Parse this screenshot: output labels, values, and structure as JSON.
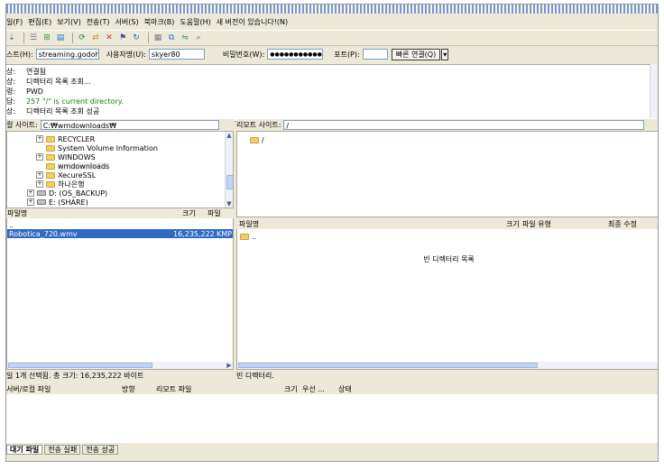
{
  "menu": [
    "일(F)",
    "편집(E)",
    "보기(V)",
    "전송(T)",
    "서버(S)",
    "북마크(B)",
    "도움말(H)",
    "새 버전이 있습니다!(N)"
  ],
  "toolbar": {
    "icons": [
      "site-manager-icon",
      "log-icon",
      "tree-icon",
      "queue-icon",
      "refresh-icon",
      "process-queue-icon",
      "cancel-icon",
      "disconnect-icon",
      "reconnect-icon",
      "filter-icon",
      "compare-icon",
      "sync-icon",
      "search-icon"
    ]
  },
  "quickconnect": {
    "host_label": "스트(H):",
    "host_value": "streaming.godohos",
    "user_label": "사용자명(U):",
    "user_value": "skyer80",
    "pass_label": "비밀번호(W):",
    "pass_value": "●●●●●●●●●●●",
    "port_label": "포트(P):",
    "port_value": "",
    "connect_label": "빠른 연결(Q)",
    "dropdown_label": "▾"
  },
  "log": [
    {
      "prefix": "상:",
      "text": "연결됨",
      "color": "#000000"
    },
    {
      "prefix": "상:",
      "text": "디렉터리 목록 조회...",
      "color": "#000000"
    },
    {
      "prefix": "령:",
      "text": "PWD",
      "color": "#000000"
    },
    {
      "prefix": "답:",
      "text": "257 \"/\" is current directory.",
      "color": "#1a7a1a"
    },
    {
      "prefix": "상:",
      "text": "디렉터리 목록 조회 성공",
      "color": "#000000"
    }
  ],
  "local": {
    "site_label": "컬 사이트:",
    "path": "C:₩wmdownloads₩",
    "tree": [
      {
        "label": "RECYCLER",
        "type": "folder",
        "expander": "+",
        "indent": 2
      },
      {
        "label": "System Volume Information",
        "type": "folder",
        "expander": "",
        "indent": 2
      },
      {
        "label": "WINDOWS",
        "type": "folder",
        "expander": "+",
        "indent": 2
      },
      {
        "label": "wmdownloads",
        "type": "folder",
        "expander": "",
        "indent": 2
      },
      {
        "label": "XecureSSL",
        "type": "folder",
        "expander": "+",
        "indent": 2
      },
      {
        "label": "하나은행",
        "type": "folder",
        "expander": "+",
        "indent": 2
      },
      {
        "label": "D: (OS_BACKUP)",
        "type": "drive",
        "expander": "+",
        "indent": 1
      },
      {
        "label": "E: (SHARE)",
        "type": "drive",
        "expander": "+",
        "indent": 1
      }
    ],
    "columns": [
      "파일명",
      "크기",
      "파일"
    ],
    "files": [
      {
        "name": "..",
        "size": "",
        "type": "",
        "selected": false
      },
      {
        "name": "Robotica_720.wmv",
        "size": "16,235,222",
        "type": "KMP",
        "selected": true
      }
    ],
    "status": "일 1개 선택됨. 총 크기: 16,235,222 바이트"
  },
  "remote": {
    "site_label": "리모트 사이트:",
    "path": "/",
    "tree": [
      {
        "label": "/"
      }
    ],
    "columns": [
      "파일명",
      "크기",
      "파일 유형",
      "최종 수정"
    ],
    "files": [
      {
        "name": ".."
      }
    ],
    "empty_message": "빈 디렉터리 목록",
    "status": "빈 디렉터리."
  },
  "queue": {
    "columns": [
      "서버/로컬 파일",
      "방향",
      "리모트 파일",
      "크기",
      "우선 ...",
      "상태"
    ],
    "tabs": [
      "대기 파일",
      "전송 실패",
      "전송 성공"
    ]
  }
}
